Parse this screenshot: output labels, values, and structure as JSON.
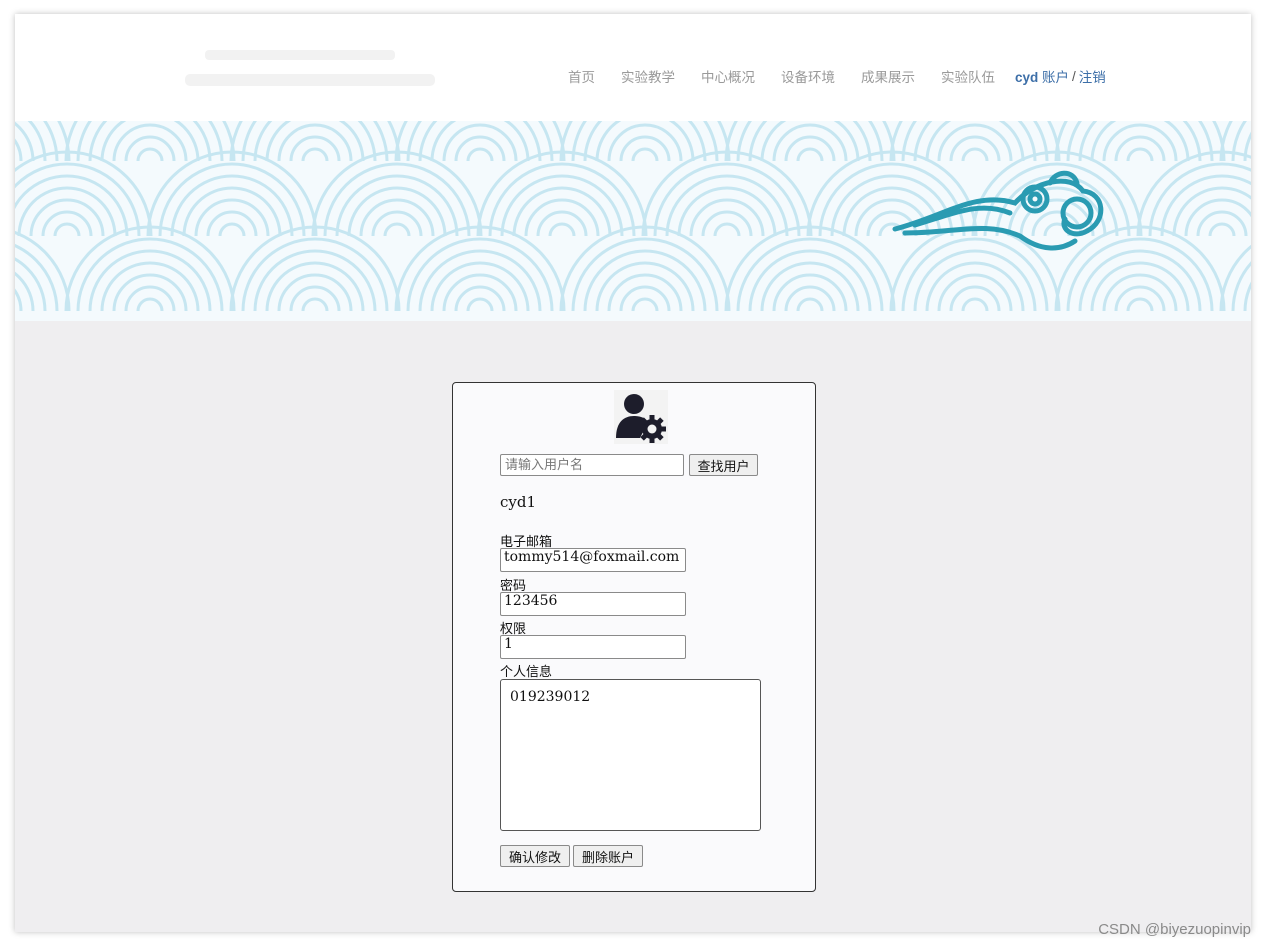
{
  "nav": {
    "items": [
      "首页",
      "实验教学",
      "中心概况",
      "设备环境",
      "成果展示",
      "实验队伍"
    ],
    "account_user": "cyd",
    "account_label": "账户",
    "separator": "/",
    "logout_label": "注销"
  },
  "panel": {
    "icon": "user-settings-icon",
    "search_placeholder": "请输入用户名",
    "search_button": "查找用户",
    "username": "cyd1",
    "email_label": "电子邮箱",
    "email_value": "tommy514@foxmail.com",
    "password_label": "密码",
    "password_value": "123456",
    "permission_label": "权限",
    "permission_value": "1",
    "info_label": "个人信息",
    "info_value": "019239012",
    "confirm_button": "确认修改",
    "delete_button": "删除账户"
  },
  "watermark": "CSDN @biyezuopinvip",
  "colors": {
    "nav_text": "#9a9a9a",
    "account_link": "#3d6fa8",
    "wave": "#c6e6f1",
    "cloud": "#2a9bb2",
    "page_bg": "#efeef0"
  }
}
